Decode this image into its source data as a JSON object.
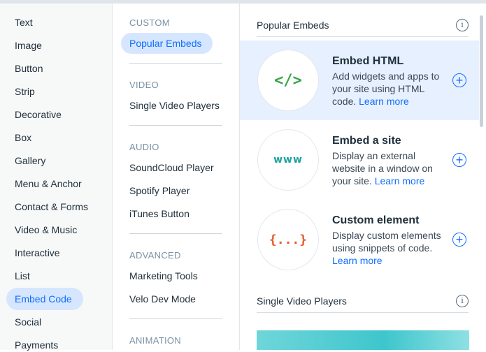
{
  "categories": {
    "items": [
      "Text",
      "Image",
      "Button",
      "Strip",
      "Decorative",
      "Box",
      "Gallery",
      "Menu & Anchor",
      "Contact & Forms",
      "Video & Music",
      "Interactive",
      "List",
      "Embed Code",
      "Social",
      "Payments"
    ],
    "selected": "Embed Code"
  },
  "subcategories": {
    "sections": [
      {
        "heading": "CUSTOM",
        "items": [
          "Popular Embeds"
        ]
      },
      {
        "heading": "VIDEO",
        "items": [
          "Single Video Players"
        ]
      },
      {
        "heading": "AUDIO",
        "items": [
          "SoundCloud Player",
          "Spotify Player",
          "iTunes Button"
        ]
      },
      {
        "heading": "ADVANCED",
        "items": [
          "Marketing Tools",
          "Velo Dev Mode"
        ]
      },
      {
        "heading": "ANIMATION",
        "items": []
      }
    ],
    "selected": "Popular Embeds"
  },
  "content": {
    "popular_title": "Popular Embeds",
    "info_glyph": "i",
    "cards": [
      {
        "icon": "</>",
        "title": "Embed HTML",
        "desc": "Add widgets and apps to your site using HTML code.",
        "learn": "Learn more",
        "icon_color": "#3aa54a"
      },
      {
        "icon": "www",
        "title": "Embed a site",
        "desc": "Display an external website in a window on your site.",
        "learn": "Learn more",
        "icon_color": "#1aa3a3"
      },
      {
        "icon": "{...}",
        "title": "Custom element",
        "desc": "Display custom elements using snippets of code.",
        "learn": "Learn more",
        "icon_color": "#e85a2a"
      }
    ],
    "plus_glyph": "+",
    "video_title": "Single Video Players"
  },
  "colors": {
    "accent": "#116dff",
    "selected_bg": "#d6e6fe",
    "highlight_card": "#e7f0ff"
  }
}
